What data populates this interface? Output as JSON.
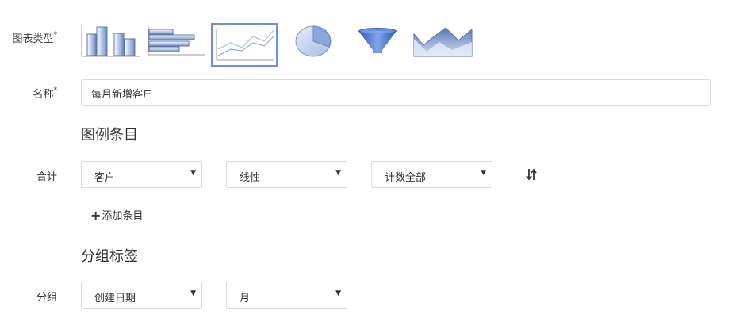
{
  "chart_type": {
    "label": "图表类型",
    "required_mark": "*",
    "options": [
      {
        "name": "column-chart-icon",
        "selected": false
      },
      {
        "name": "bar-chart-icon",
        "selected": false
      },
      {
        "name": "line-chart-icon",
        "selected": true
      },
      {
        "name": "pie-chart-icon",
        "selected": false
      },
      {
        "name": "funnel-chart-icon",
        "selected": false
      },
      {
        "name": "area-chart-icon",
        "selected": false
      }
    ]
  },
  "name_field": {
    "label": "名称",
    "required_mark": "*",
    "value": "每月新增客户"
  },
  "legend_section": {
    "title": "图例条目",
    "row_label": "合计",
    "object_select": "客户",
    "style_select": "线性",
    "aggregate_select": "计数全部",
    "add_label": "添加条目"
  },
  "group_section": {
    "title": "分组标签",
    "row_label": "分组",
    "field_select": "创建日期",
    "period_select": "月"
  },
  "colors": {
    "accent": "#6b8fe6",
    "chart_blue": "#5b7fc4",
    "chart_light": "#b8c8e6",
    "border": "#dcdcdc"
  }
}
